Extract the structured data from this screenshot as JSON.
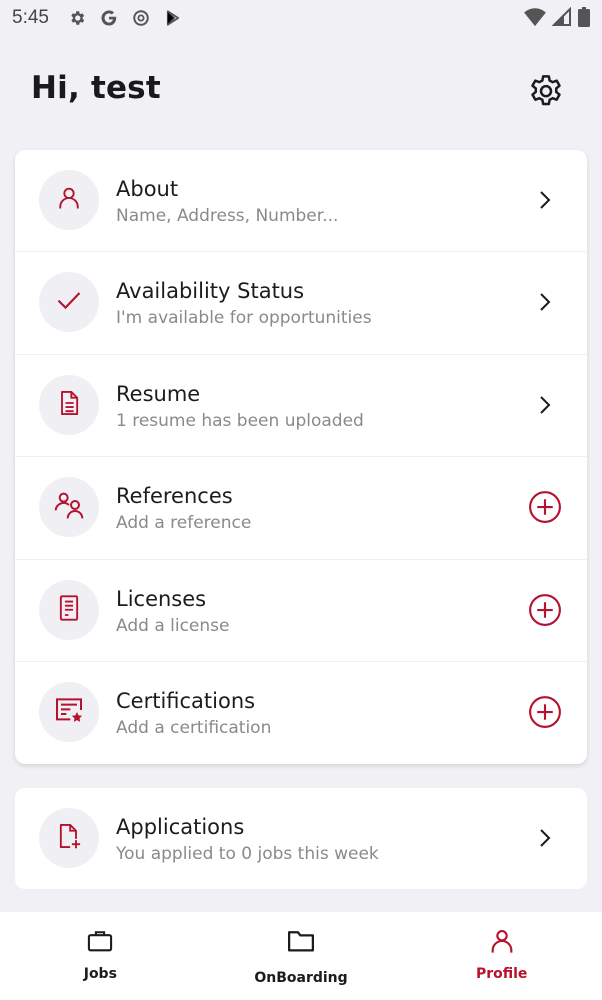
{
  "status_bar": {
    "time": "5:45",
    "left_icons": [
      "gear-icon",
      "google-icon",
      "at-icon",
      "play-store-icon"
    ],
    "right_icons": [
      "wifi-icon",
      "signal-icon",
      "battery-icon"
    ]
  },
  "header": {
    "greeting": "Hi, test",
    "settings_icon": "gear-icon"
  },
  "colors": {
    "accent": "#b5122f",
    "background": "#f1f0f5",
    "card": "#ffffff",
    "icon_circle": "#f0eff3",
    "subtitle": "#8a8a8e"
  },
  "profile_sections": [
    {
      "title": "About",
      "subtitle": "Name, Address, Number...",
      "icon": "person-icon",
      "action": "chevron-right-icon"
    },
    {
      "title": "Availability Status",
      "subtitle": "I'm available for opportunities",
      "icon": "check-icon",
      "action": "chevron-right-icon"
    },
    {
      "title": "Resume",
      "subtitle": "1 resume has been uploaded",
      "icon": "document-icon",
      "action": "chevron-right-icon"
    },
    {
      "title": "References",
      "subtitle": "Add a reference",
      "icon": "people-icon",
      "action": "add-circle-icon"
    },
    {
      "title": "Licenses",
      "subtitle": "Add a license",
      "icon": "license-icon",
      "action": "add-circle-icon"
    },
    {
      "title": "Certifications",
      "subtitle": "Add a certification",
      "icon": "certificate-icon",
      "action": "add-circle-icon"
    }
  ],
  "applications": {
    "title": "Applications",
    "subtitle": "You applied to 0 jobs this week",
    "icon": "file-add-icon",
    "action": "chevron-right-icon"
  },
  "bottom_nav": [
    {
      "label": "Jobs",
      "icon": "briefcase-icon",
      "active": false
    },
    {
      "label": "OnBoarding",
      "icon": "folder-icon",
      "active": false
    },
    {
      "label": "Profile",
      "icon": "person-icon",
      "active": true
    }
  ]
}
